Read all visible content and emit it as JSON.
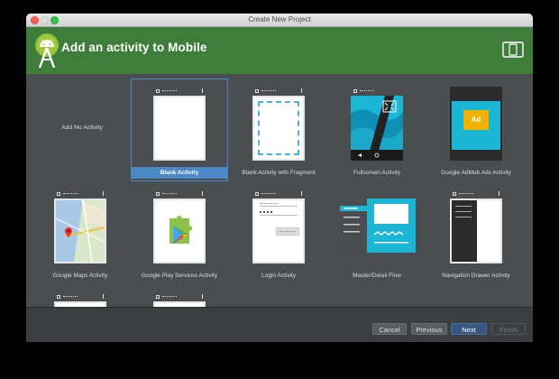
{
  "window": {
    "title": "Create New Project"
  },
  "banner": {
    "title": "Add an activity to Mobile"
  },
  "tiles": [
    {
      "label": "Add No Activity"
    },
    {
      "label": "Blank Activity",
      "selected": true
    },
    {
      "label": "Blank Activity with Fragment"
    },
    {
      "label": "Fullscreen Activity"
    },
    {
      "label": "Google AdMob Ads Activity",
      "ad_text": "Ad"
    },
    {
      "label": "Google Maps Activity"
    },
    {
      "label": "Google Play Services Activity"
    },
    {
      "label": "Login Activity"
    },
    {
      "label": "Master/Detail Flow"
    },
    {
      "label": "Navigation Drawer Activity"
    }
  ],
  "buttons": {
    "cancel": "Cancel",
    "previous": "Previous",
    "next": "Next",
    "finish": "Finish"
  },
  "colors": {
    "banner": "#3f7d3a",
    "selection": "#4a88c7",
    "fullscreen_teal": "#1bb5d6"
  }
}
